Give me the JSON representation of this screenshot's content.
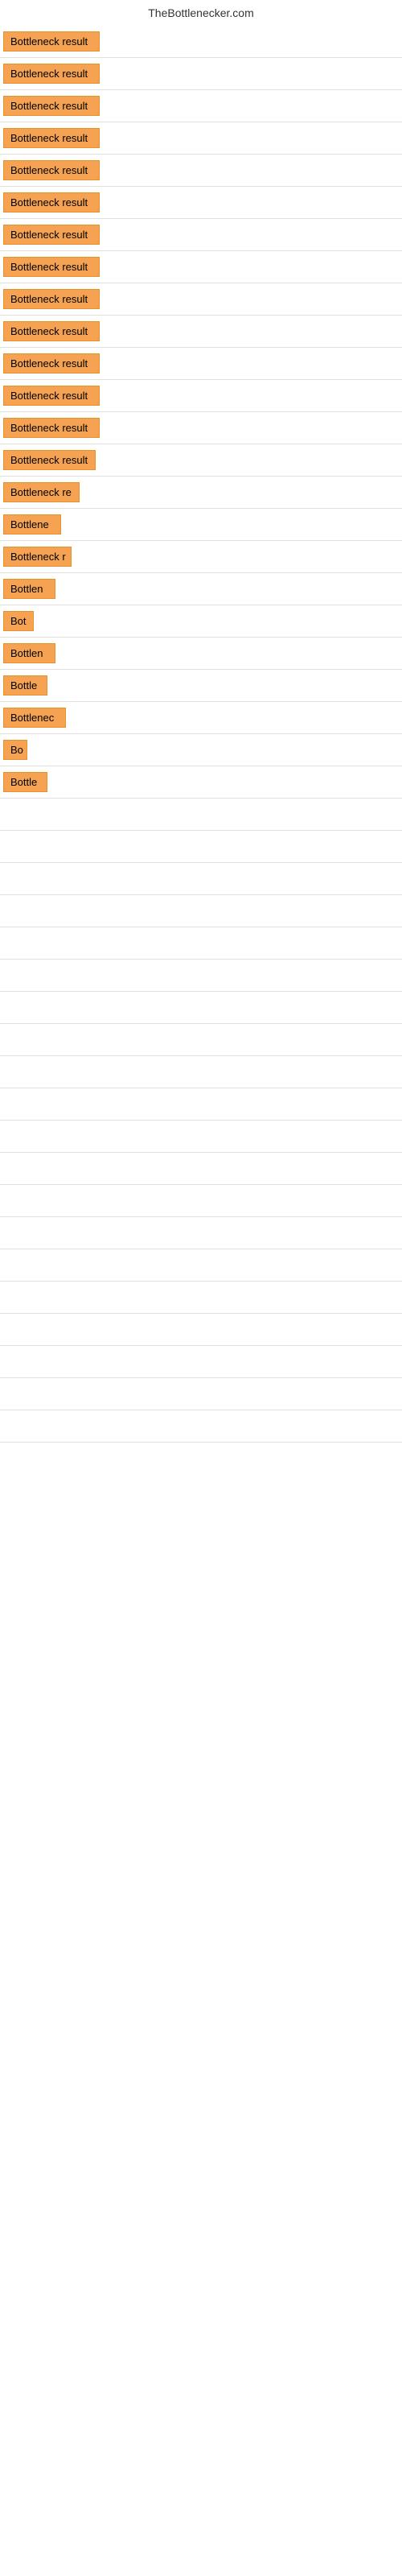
{
  "site": {
    "title": "TheBottlenecker.com"
  },
  "items": [
    {
      "id": 1,
      "label": "Bottleneck result",
      "width": 120
    },
    {
      "id": 2,
      "label": "Bottleneck result",
      "width": 120
    },
    {
      "id": 3,
      "label": "Bottleneck result",
      "width": 120
    },
    {
      "id": 4,
      "label": "Bottleneck result",
      "width": 120
    },
    {
      "id": 5,
      "label": "Bottleneck result",
      "width": 120
    },
    {
      "id": 6,
      "label": "Bottleneck result",
      "width": 120
    },
    {
      "id": 7,
      "label": "Bottleneck result",
      "width": 120
    },
    {
      "id": 8,
      "label": "Bottleneck result",
      "width": 120
    },
    {
      "id": 9,
      "label": "Bottleneck result",
      "width": 120
    },
    {
      "id": 10,
      "label": "Bottleneck result",
      "width": 120
    },
    {
      "id": 11,
      "label": "Bottleneck result",
      "width": 120
    },
    {
      "id": 12,
      "label": "Bottleneck result",
      "width": 120
    },
    {
      "id": 13,
      "label": "Bottleneck result",
      "width": 120
    },
    {
      "id": 14,
      "label": "Bottleneck result",
      "width": 115
    },
    {
      "id": 15,
      "label": "Bottleneck re",
      "width": 95
    },
    {
      "id": 16,
      "label": "Bottlene",
      "width": 72
    },
    {
      "id": 17,
      "label": "Bottleneck r",
      "width": 85
    },
    {
      "id": 18,
      "label": "Bottlen",
      "width": 65
    },
    {
      "id": 19,
      "label": "Bot",
      "width": 38
    },
    {
      "id": 20,
      "label": "Bottlen",
      "width": 65
    },
    {
      "id": 21,
      "label": "Bottle",
      "width": 55
    },
    {
      "id": 22,
      "label": "Bottlenec",
      "width": 78
    },
    {
      "id": 23,
      "label": "Bo",
      "width": 30
    },
    {
      "id": 24,
      "label": "Bottle",
      "width": 55
    }
  ],
  "colors": {
    "badge_bg": "#f5a352",
    "badge_border": "#e8922a",
    "title_color": "#333333"
  }
}
